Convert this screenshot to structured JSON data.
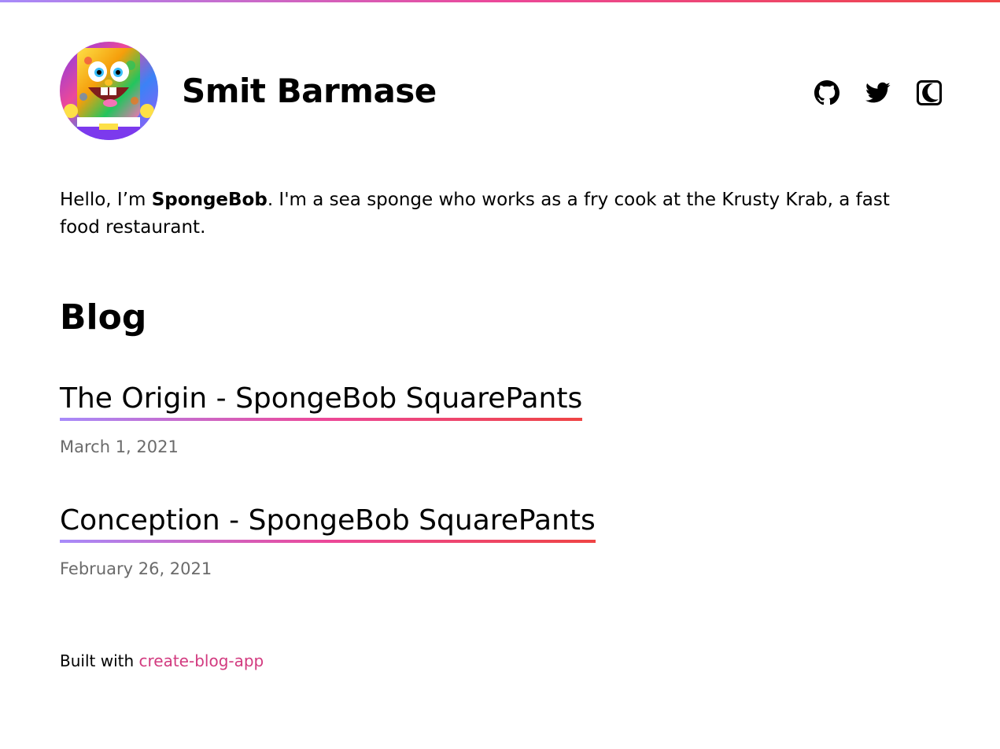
{
  "header": {
    "avatar_alt": "SpongeBob avatar",
    "title": "Smit Barmase",
    "icons": [
      "github-icon",
      "twitter-icon",
      "dark-mode-icon"
    ]
  },
  "bio": {
    "greeting": "Hello, I’m ",
    "name": "SpongeBob",
    "text": ". I'm a sea sponge who works as a fry cook at the Krusty Krab, a fast food restaurant."
  },
  "blog": {
    "heading": "Blog",
    "posts": [
      {
        "title": "The Origin - SpongeBob SquarePants",
        "date": "March 1, 2021"
      },
      {
        "title": "Conception - SpongeBob SquarePants",
        "date": "February 26, 2021"
      }
    ]
  },
  "footer": {
    "prefix": "Built with ",
    "link_text": "create-blog-app"
  },
  "colors": {
    "gradient_start": "#a78bfa",
    "gradient_mid": "#ec4899",
    "gradient_end": "#ef4444",
    "link": "#d23a7f",
    "date": "#6b6b6b"
  }
}
